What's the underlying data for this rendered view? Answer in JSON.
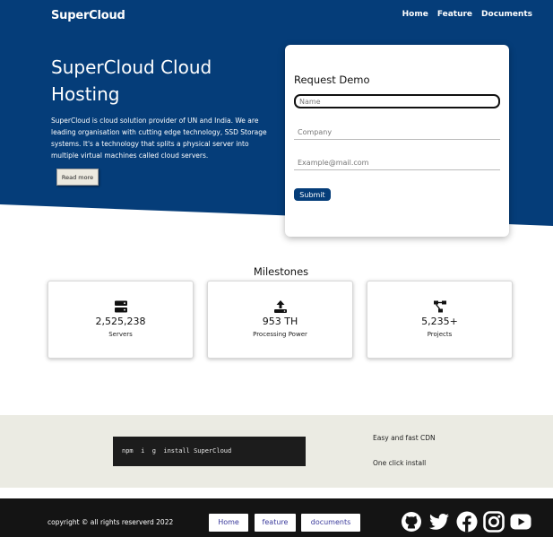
{
  "header": {
    "brand": "SuperCloud",
    "nav": [
      "Home",
      "Feature",
      "Documents"
    ]
  },
  "hero": {
    "title": "SuperCloud Cloud Hosting",
    "description": "SuperCloud is cloud solution provider of UN and India. We are leading organisation with cutting edge technology, SSD Storage systems. It's a technology that splits a physical server into multiple virtual machines called cloud servers.",
    "read_more": "Read more"
  },
  "demo_form": {
    "title": "Request Demo",
    "name_placeholder": "Name",
    "company_placeholder": "Company",
    "email_placeholder": "Example@mail.com",
    "submit": "Submit"
  },
  "milestones": {
    "title": "Milestones",
    "items": [
      {
        "icon": "server-icon",
        "value": "2,525,238",
        "label": "Servers"
      },
      {
        "icon": "upload-icon",
        "value": "953 TH",
        "label": "Processing Power"
      },
      {
        "icon": "project-diagram-icon",
        "value": "5,235+",
        "label": "Projects"
      }
    ]
  },
  "install": {
    "command": "npm  i  g  install SuperCloud",
    "features": [
      "Easy and fast CDN",
      "One click install"
    ]
  },
  "footer": {
    "copyright": "copyright © all rights reserverd 2022",
    "links": [
      "Home",
      "feature",
      "documents"
    ],
    "social": [
      "github-icon",
      "twitter-icon",
      "facebook-icon",
      "instagram-icon",
      "youtube-icon"
    ]
  },
  "colors": {
    "primary": "#053d79",
    "band": "#ebebe3",
    "footer": "#141414",
    "code_bg": "#1c1c1c"
  }
}
